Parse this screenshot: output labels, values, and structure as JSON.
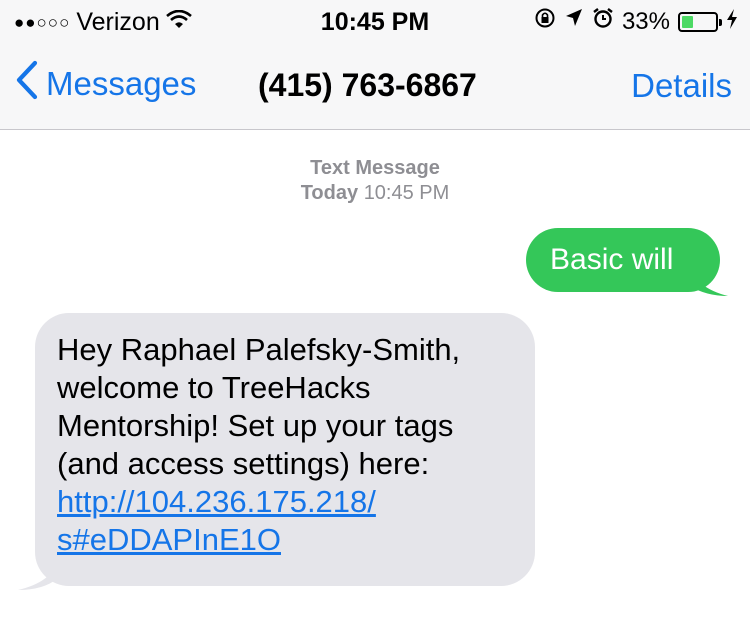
{
  "status_bar": {
    "signal_dots": "●●○○○",
    "carrier": "Verizon",
    "time": "10:45 PM",
    "battery_percent_label": "33%",
    "battery_level": 0.33,
    "icons": [
      "wifi-icon",
      "rotation-lock-icon",
      "location-arrow-icon",
      "alarm-icon",
      "battery-icon",
      "charging-bolt-icon"
    ]
  },
  "nav": {
    "back_label": "Messages",
    "title": "(415) 763-6867",
    "details_label": "Details"
  },
  "thread": {
    "header_type": "Text Message",
    "header_day": "Today",
    "header_time": "10:45 PM",
    "messages": [
      {
        "direction": "sent",
        "text": "Basic will"
      },
      {
        "direction": "received",
        "lines": [
          "Hey Raphael Palefsky-Smith,",
          "welcome to TreeHacks",
          "Mentorship! Set up your tags",
          "(and access settings) here:"
        ],
        "link_lines": [
          "http://104.236.175.218/",
          "s#eDDAPInE1O"
        ]
      }
    ]
  },
  "colors": {
    "accent": "#1575e8",
    "sent_bubble": "#34c759",
    "received_bubble": "#e5e5ea",
    "battery_fill": "#4cd964",
    "timestamp_gray": "#8e8e93"
  }
}
